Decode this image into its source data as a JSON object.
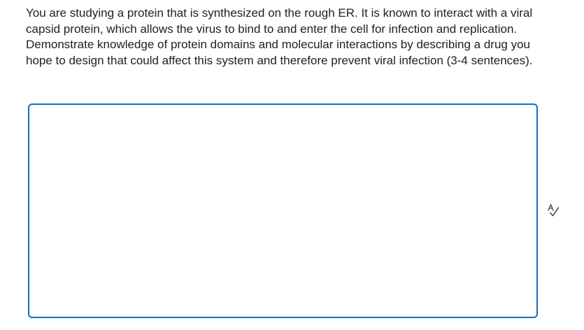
{
  "question": {
    "text": "You are studying a protein that is synthesized on the rough ER. It is known to interact with a viral capsid protein, which allows the virus to bind to and enter the cell for infection and replication.  Demonstrate knowledge of protein domains and molecular interactions by describing a drug you hope to design that could affect this system and therefore prevent viral infection (3-4 sentences)."
  },
  "answer": {
    "value": "",
    "placeholder": ""
  },
  "icons": {
    "spellcheck": "spellcheck-icon"
  },
  "colors": {
    "border_accent": "#1a6bbd",
    "text": "#202122"
  }
}
